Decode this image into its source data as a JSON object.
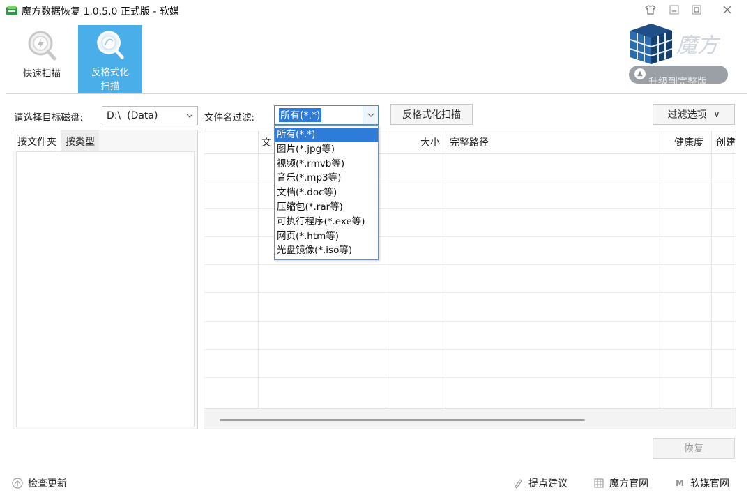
{
  "window": {
    "title": "魔方数据恢复 1.0.5.0 正式版 - 软媒",
    "controls": [
      "shirt-icon",
      "minimize-icon",
      "maximize-icon",
      "close-icon"
    ]
  },
  "toolbar": {
    "quick_scan": "快速扫描",
    "unformat_scan_line1": "反格式化",
    "unformat_scan_line2": "扫描",
    "active_color": "#4aaee8"
  },
  "brand": {
    "logo_text": "魔方",
    "upgrade_text": "升级到完整版"
  },
  "filters": {
    "disk_label": "请选择目标磁盘:",
    "disk_value": "D:\\  (Data)",
    "name_filter_label": "文件名过滤:",
    "name_filter_value": "所有(*.*)",
    "scan_button": "反格式化扫描",
    "filter_options_button": "过滤选项",
    "filter_options_caret": "∨"
  },
  "left_panel": {
    "tabs": [
      "按文件夹",
      "按类型"
    ]
  },
  "table": {
    "columns": [
      "文",
      "大小",
      "完整路径",
      "健康度",
      "创建"
    ]
  },
  "dropdown": {
    "items": [
      "所有(*.*)",
      "图片(*.jpg等)",
      "视频(*.rmvb等)",
      "音乐(*.mp3等)",
      "文档(*.doc等)",
      "压缩包(*.rar等)",
      "可执行程序(*.exe等)",
      "网页(*.htm等)",
      "光盘镜像(*.iso等)"
    ],
    "selected": "所有(*.*)",
    "highlight_color": "#2f7bd8"
  },
  "actions": {
    "recover": "恢复"
  },
  "statusbar": {
    "check_update": "检查更新",
    "feedback": "提点建议",
    "official_site": "魔方官网",
    "ruanmei_site": "软媒官网"
  }
}
